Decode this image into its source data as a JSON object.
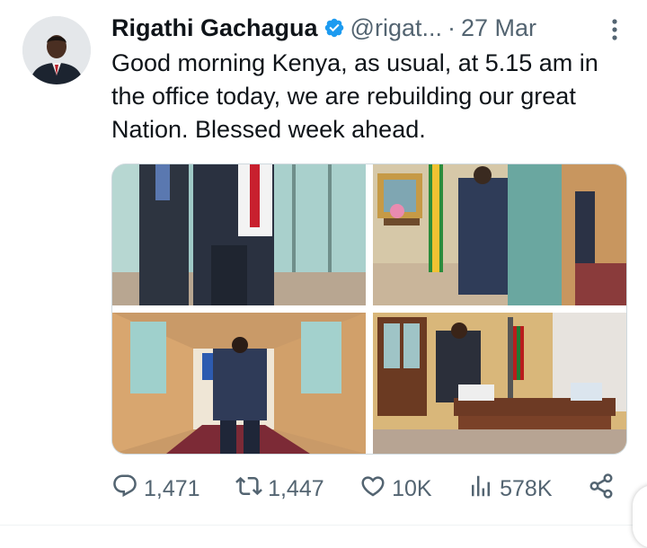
{
  "tweet": {
    "author_name": "Rigathi Gachagua",
    "handle": "@rigat...",
    "separator": "·",
    "date": "27 Mar",
    "text": "Good morning Kenya, as usual, at 5.15 am in the office today, we are rebuilding our great Nation. Blessed week ahead."
  },
  "actions": {
    "replies": "1,471",
    "retweets": "1,447",
    "likes": "10K",
    "views": "578K"
  },
  "icons": {
    "verified": "verified-badge-icon",
    "more": "more-vertical-icon",
    "reply": "reply-icon",
    "retweet": "retweet-icon",
    "like": "heart-icon",
    "views": "views-chart-icon",
    "share": "share-icon"
  },
  "colors": {
    "text": "#0f1419",
    "secondary": "#536471",
    "verified": "#1d9bf0"
  }
}
